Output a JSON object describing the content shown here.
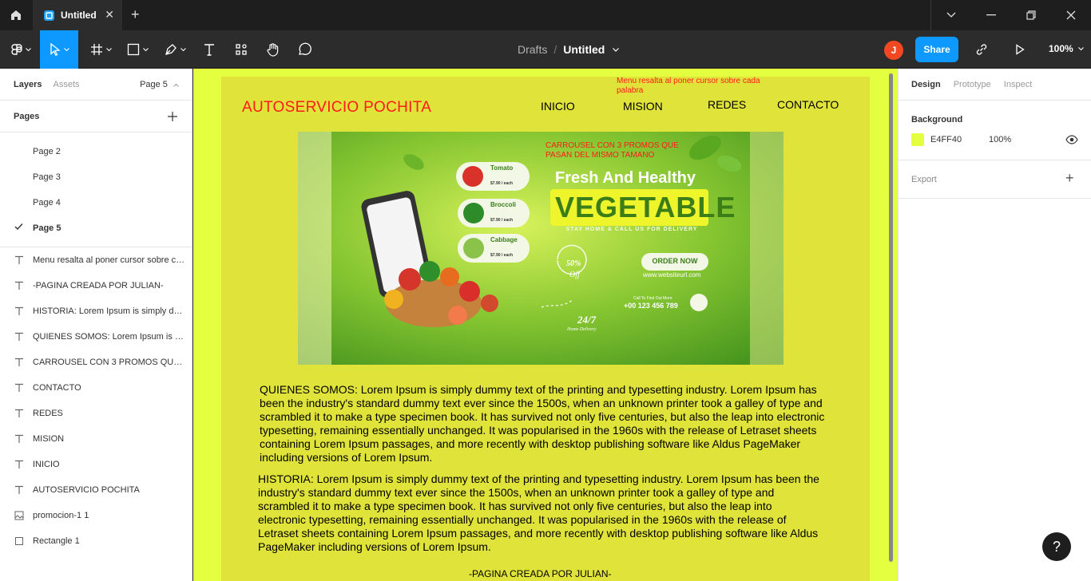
{
  "titlebar": {
    "tab_title": "Untitled",
    "tab_close": "✕",
    "new_tab": "+"
  },
  "toolbar": {
    "breadcrumb_parent": "Drafts",
    "breadcrumb_sep": "/",
    "file_name": "Untitled",
    "avatar_initial": "J",
    "share_label": "Share",
    "zoom_label": "100%"
  },
  "left_panel": {
    "tab_layers": "Layers",
    "tab_assets": "Assets",
    "current_page": "Page 5",
    "pages_heading": "Pages",
    "pages": [
      {
        "label": "Page 2",
        "selected": false
      },
      {
        "label": "Page 3",
        "selected": false
      },
      {
        "label": "Page 4",
        "selected": false
      },
      {
        "label": "Page 5",
        "selected": true
      }
    ],
    "layers": [
      {
        "label": "Menu resalta al poner cursor sobre cada palabra",
        "icon": "text-icon"
      },
      {
        "label": "-PAGINA CREADA POR JULIAN-",
        "icon": "text-icon"
      },
      {
        "label": "HISTORIA: Lorem Ipsum is simply dummy text",
        "icon": "text-icon"
      },
      {
        "label": "QUIENES SOMOS: Lorem Ipsum is simply dummy text",
        "icon": "text-icon"
      },
      {
        "label": "CARROUSEL CON 3 PROMOS QUE PASAN DEL MISMO TAMANO",
        "icon": "text-icon"
      },
      {
        "label": "CONTACTO",
        "icon": "text-icon"
      },
      {
        "label": "REDES",
        "icon": "text-icon"
      },
      {
        "label": "MISION",
        "icon": "text-icon"
      },
      {
        "label": "INICIO",
        "icon": "text-icon"
      },
      {
        "label": "AUTOSERVICIO POCHITA",
        "icon": "text-icon"
      },
      {
        "label": "promocion-1 1",
        "icon": "image-icon"
      },
      {
        "label": "Rectangle 1",
        "icon": "rectangle-icon"
      }
    ]
  },
  "canvas": {
    "bg_color": "#E4FF40",
    "site_title": "AUTOSERVICIO POCHITA",
    "nav": {
      "inicio": "INICIO",
      "mision": "MISION",
      "redes": "REDES",
      "contacto": "CONTACTO"
    },
    "menu_note": "Menu resalta al poner cursor sobre cada palabra",
    "carousel_note": "CARROUSEL CON 3 PROMOS QUE PASAN DEL MISMO TAMANO",
    "promo": {
      "headline": "Fresh And Healthy",
      "title": "VEGETABLE",
      "tagline": "STAY HOME & CALL US FOR DELIVERY",
      "order_btn": "ORDER NOW",
      "website": "www.websiteurl.com",
      "call_label": "Call To Find Out More",
      "phone": "+00 123 456 789",
      "discount": "50%",
      "discount_sub": "Off",
      "hours": "24/7",
      "hours_sub": "Home Delivery",
      "products": [
        {
          "name": "Tomato",
          "price": "$7.90 / each"
        },
        {
          "name": "Broccoli",
          "price": "$7.90 / each"
        },
        {
          "name": "Cabbage",
          "price": "$7.90 / each"
        }
      ]
    },
    "quienes_somos": "QUIENES SOMOS: Lorem Ipsum is simply dummy text of the printing and typesetting industry. Lorem Ipsum has been the industry's standard dummy text ever since the 1500s, when an unknown printer took a galley of type and scrambled it to make a type specimen book. It has survived not only five centuries, but also the leap into electronic typesetting, remaining essentially unchanged. It was popularised in the 1960s with the release of Letraset sheets containing Lorem Ipsum passages, and more recently with desktop publishing software like Aldus PageMaker including versions of Lorem Ipsum.",
    "historia": "HISTORIA: Lorem Ipsum is simply dummy text of the printing and typesetting industry. Lorem Ipsum has been the industry's standard dummy text ever since the 1500s, when an unknown printer took a galley of type and scrambled it to make a type specimen book. It has survived not only five centuries, but also the leap into electronic typesetting, remaining essentially unchanged. It was popularised in the 1960s with the release of Letraset sheets containing Lorem Ipsum passages, and more recently with desktop publishing software like Aldus PageMaker including versions of Lorem Ipsum.",
    "footer": "-PAGINA CREADA POR JULIAN-"
  },
  "right_panel": {
    "tabs": [
      "Design",
      "Prototype",
      "Inspect"
    ],
    "background_heading": "Background",
    "bg_hex": "E4FF40",
    "bg_opacity": "100%",
    "export_label": "Export",
    "export_plus": "+"
  },
  "help_label": "?",
  "colors": {
    "accent": "#0d99ff",
    "avatar": "#f24822",
    "canvas_bg": "#E4FF40",
    "frame_bg": "#e0e33a",
    "note_red": "#ff1a1a"
  }
}
